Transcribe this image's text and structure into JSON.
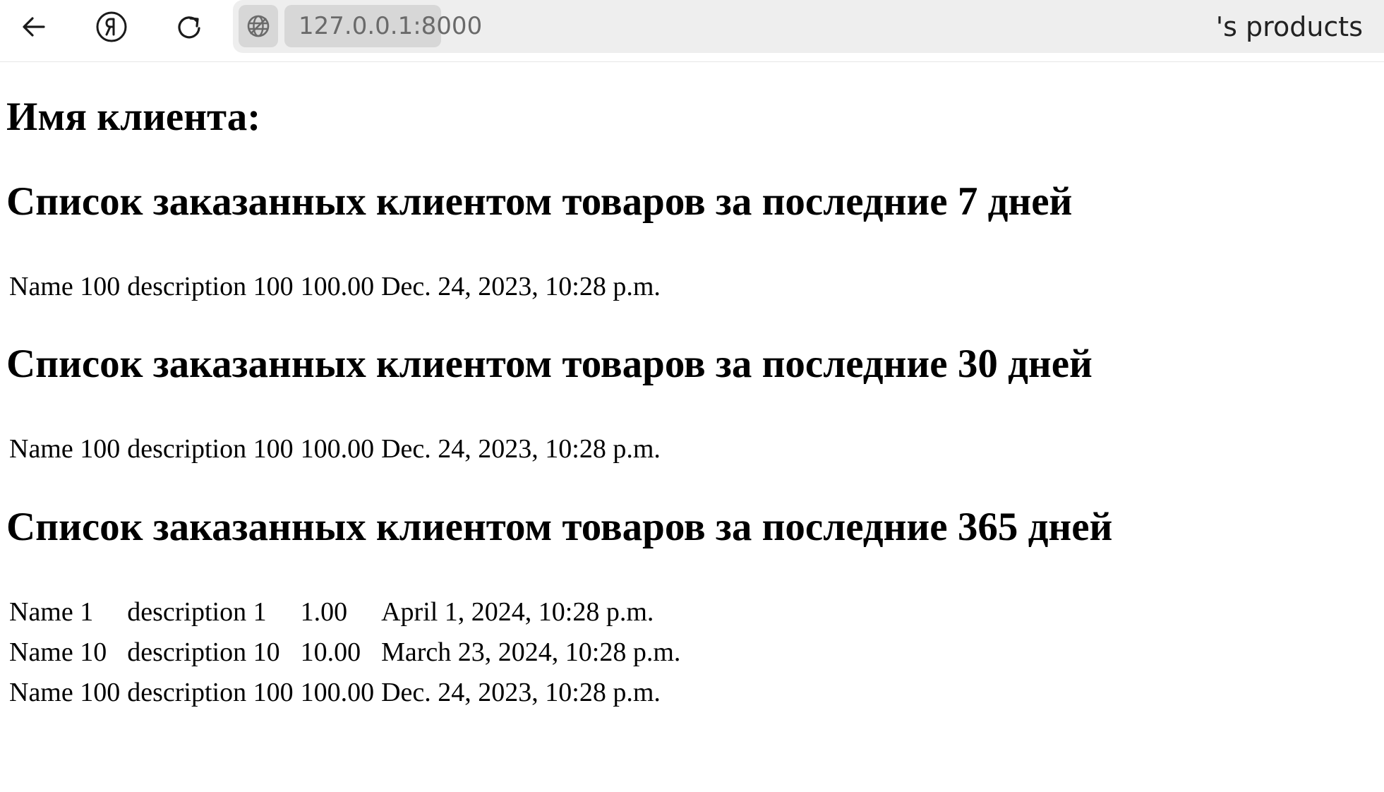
{
  "browser": {
    "url": "127.0.0.1:8000",
    "tab_title": "'s products",
    "buttons": [
      "back-icon",
      "yandex-icon",
      "reload-icon"
    ],
    "site_icon": "globe-icon"
  },
  "page": {
    "client_heading": "Имя клиента:",
    "sections": [
      {
        "title": "Список заказанных клиентом товаров за последние 7 дней",
        "rows": [
          {
            "name": "Name 100",
            "description": "description 100",
            "price": "100.00",
            "date": "Dec. 24, 2023, 10:28 p.m."
          }
        ]
      },
      {
        "title": "Список заказанных клиентом товаров за последние 30 дней",
        "rows": [
          {
            "name": "Name 100",
            "description": "description 100",
            "price": "100.00",
            "date": "Dec. 24, 2023, 10:28 p.m."
          }
        ]
      },
      {
        "title": "Список заказанных клиентом товаров за последние 365 дней",
        "rows": [
          {
            "name": "Name 1",
            "description": "description 1",
            "price": "1.00",
            "date": "April 1, 2024, 10:28 p.m."
          },
          {
            "name": "Name 10",
            "description": "description 10",
            "price": "10.00",
            "date": "March 23, 2024, 10:28 p.m."
          },
          {
            "name": "Name 100",
            "description": "description 100",
            "price": "100.00",
            "date": "Dec. 24, 2023, 10:28 p.m."
          }
        ]
      }
    ]
  }
}
